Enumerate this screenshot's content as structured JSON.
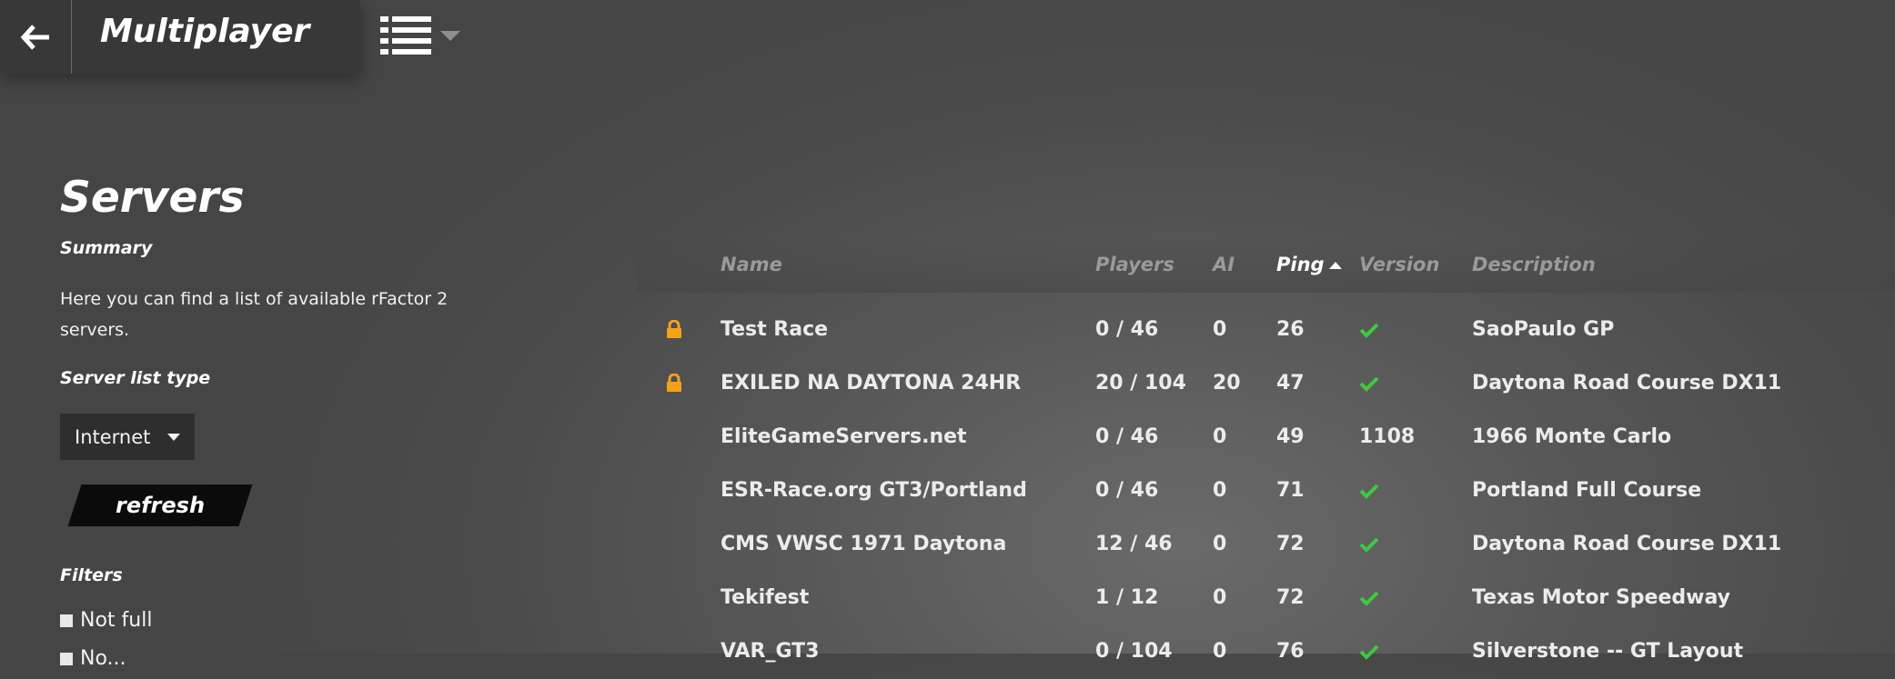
{
  "header": {
    "back_icon": "arrow-left-icon",
    "title": "Multiplayer",
    "view_icon": "list-view-icon"
  },
  "sidebar": {
    "title": "Servers",
    "summary_label": "Summary",
    "summary_text": "Here you can find a list of available rFactor 2 servers.",
    "server_list_type_label": "Server list type",
    "server_list_type_value": "Internet",
    "refresh_label": "refresh",
    "filters_label": "Filters",
    "filters": [
      {
        "label": "Not full",
        "checked": false
      },
      {
        "label": "No...",
        "checked": false
      }
    ]
  },
  "table": {
    "columns": [
      "Name",
      "Players",
      "AI",
      "Ping",
      "Version",
      "Description"
    ],
    "sort_column": "Ping",
    "sort_direction": "ascending",
    "rows": [
      {
        "locked": true,
        "name": "Test Race",
        "players": "0 / 46",
        "ai": "0",
        "ping": "26",
        "version": "check",
        "description": "SaoPaulo GP"
      },
      {
        "locked": true,
        "name": "EXILED NA DAYTONA 24HR",
        "players": "20 / 104",
        "ai": "20",
        "ping": "47",
        "version": "check",
        "description": "Daytona Road Course DX11"
      },
      {
        "locked": false,
        "name": "EliteGameServers.net",
        "players": "0 / 46",
        "ai": "0",
        "ping": "49",
        "version": "1108",
        "description": "1966 Monte Carlo"
      },
      {
        "locked": false,
        "name": "ESR-Race.org GT3/Portland",
        "players": "0 / 46",
        "ai": "0",
        "ping": "71",
        "version": "check",
        "description": "Portland Full Course"
      },
      {
        "locked": false,
        "name": "CMS VWSC 1971 Daytona",
        "players": "12 / 46",
        "ai": "0",
        "ping": "72",
        "version": "check",
        "description": "Daytona Road Course DX11"
      },
      {
        "locked": false,
        "name": "Tekifest",
        "players": "1 / 12",
        "ai": "0",
        "ping": "72",
        "version": "check",
        "description": "Texas Motor Speedway"
      },
      {
        "locked": false,
        "name": "VAR_GT3",
        "players": "0 / 104",
        "ai": "0",
        "ping": "76",
        "version": "check",
        "description": "Silverstone -- GT Layout"
      }
    ]
  },
  "colors": {
    "lock": "#f5a21b",
    "check": "#3ec93e"
  }
}
